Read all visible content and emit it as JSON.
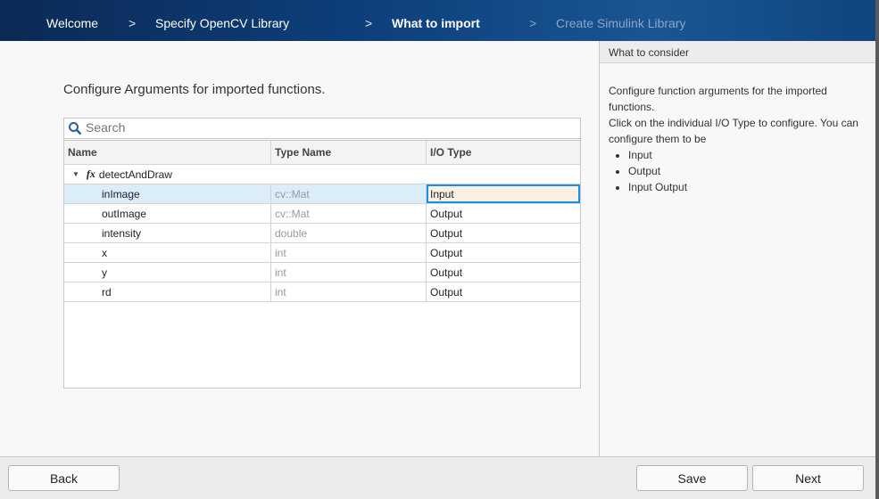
{
  "steps": [
    "Welcome",
    "Specify OpenCV Library",
    "What to import",
    "Create Simulink Library"
  ],
  "step_sep": ">",
  "current_step": "What to import",
  "main": {
    "title": "Configure Arguments for imported functions.",
    "search_placeholder": "Search",
    "columns": [
      "Name",
      "Type Name",
      "I/O Type"
    ],
    "function": "detectAndDraw",
    "function_icon": "fx",
    "rows": [
      {
        "name": "inImage",
        "type": "cv::Mat",
        "io": "Input"
      },
      {
        "name": "outImage",
        "type": "cv::Mat",
        "io": "Output"
      },
      {
        "name": "intensity",
        "type": "double",
        "io": "Output"
      },
      {
        "name": "x",
        "type": "int",
        "io": "Output"
      },
      {
        "name": "y",
        "type": "int",
        "io": "Output"
      },
      {
        "name": "rd",
        "type": "int",
        "io": "Output"
      }
    ]
  },
  "side": {
    "title": "What to consider",
    "text1": "Configure function arguments for the imported functions.",
    "text2": "Click on the individual I/O Type to configure. You can configure them to be",
    "options": [
      "Input",
      "Output",
      "Input Output"
    ]
  },
  "footer": {
    "back": "Back",
    "save": "Save",
    "next": "Next"
  },
  "colors": {
    "header": "#0d3e7a",
    "selection": "#dcedfa",
    "focus": "#1a8fe6"
  }
}
